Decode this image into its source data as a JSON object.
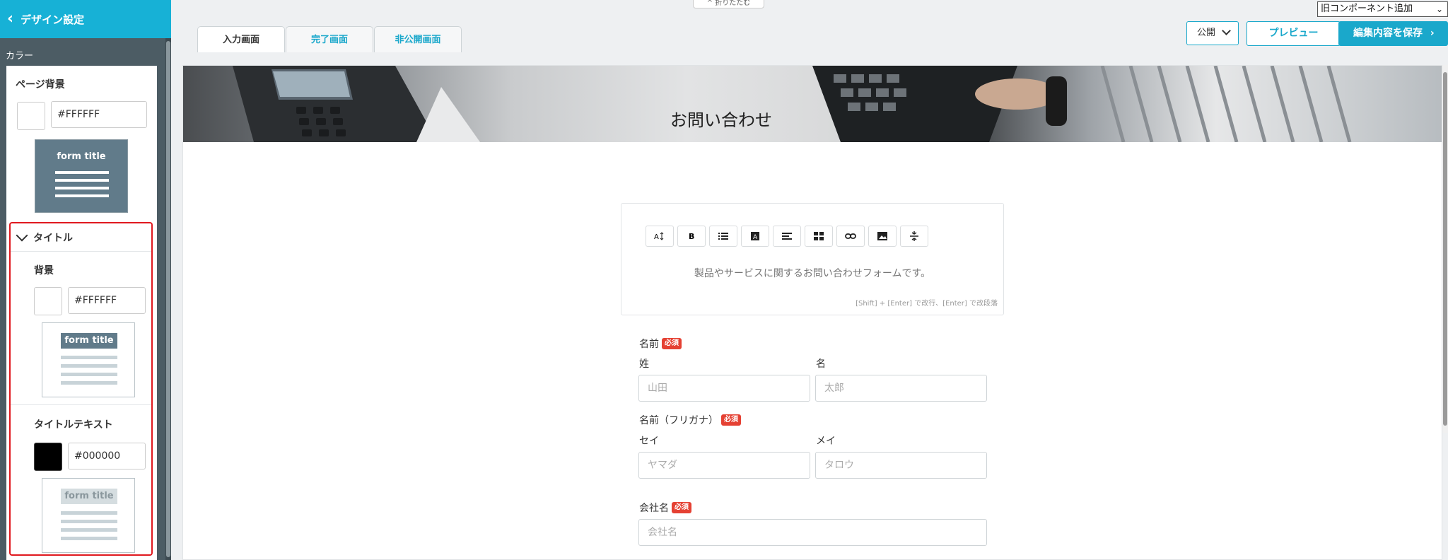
{
  "sidebar": {
    "back_label": "デザイン設定",
    "section_label": "カラー",
    "page_bg": {
      "title": "ページ背景",
      "hex": "#FFFFFF",
      "preview_title": "form title"
    },
    "title_section": {
      "header": "タイトル",
      "bg": {
        "title": "背景",
        "hex": "#FFFFFF",
        "preview_title": "form title"
      },
      "text": {
        "title": "タイトルテキスト",
        "hex": "#000000",
        "preview_title": "form title"
      }
    }
  },
  "topbar": {
    "collapse_label": "^ 折りたたむ",
    "legacy_select": "旧コンポーネント追加",
    "tabs": [
      "入力画面",
      "完了画面",
      "非公開画面"
    ],
    "publish_label": "公開",
    "preview_label": "プレビュー",
    "save_label": "編集内容を保存"
  },
  "form": {
    "title": "お問い合わせ",
    "description": "製品やサービスに関するお問い合わせフォームです。",
    "editor_hint": "[Shift] + [Enter] で改行、[Enter] で改段落",
    "toolbar_icons": [
      "text-size-icon",
      "bold-icon",
      "list-icon",
      "text-color-icon",
      "align-left-icon",
      "table-icon",
      "link-icon",
      "image-icon",
      "divider-icon"
    ],
    "required_badge": "必須",
    "name": {
      "label": "名前",
      "last_label": "姓",
      "first_label": "名",
      "last_placeholder": "山田",
      "first_placeholder": "太郎"
    },
    "kana": {
      "label": "名前（フリガナ）",
      "last_label": "セイ",
      "first_label": "メイ",
      "last_placeholder": "ヤマダ",
      "first_placeholder": "タロウ"
    },
    "company": {
      "label": "会社名",
      "placeholder": "会社名"
    }
  },
  "colors": {
    "accent": "#1aa8cb",
    "sidebar_bg": "#4c5c64",
    "required": "#e54133",
    "highlight_border": "#e0191f"
  }
}
